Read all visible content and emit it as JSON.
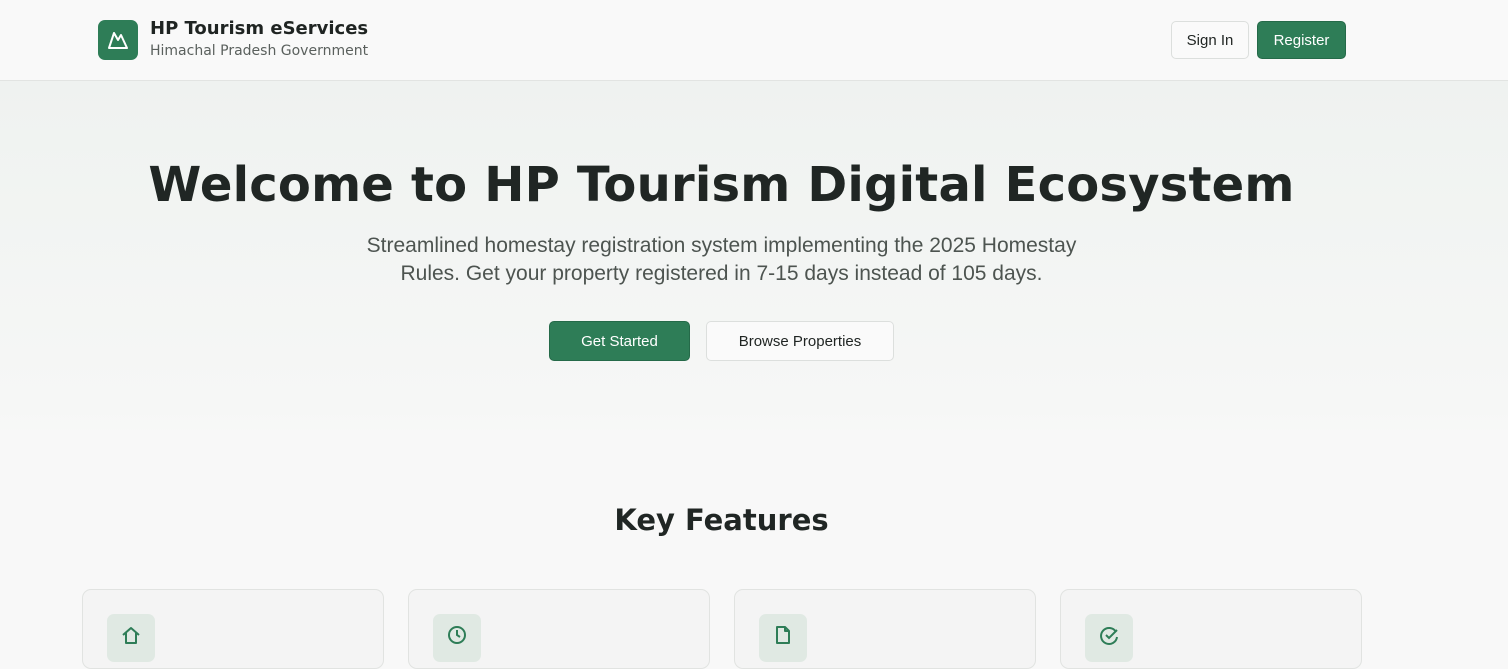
{
  "header": {
    "logo_icon": "mountain-icon",
    "title": "HP Tourism eServices",
    "subtitle": "Himachal Pradesh Government",
    "signin_label": "Sign In",
    "register_label": "Register"
  },
  "hero": {
    "title": "Welcome to HP Tourism Digital Ecosystem",
    "subtitle": "Streamlined homestay registration system implementing the 2025 Homestay Rules. Get your property registered in 7-15 days instead of 105 days.",
    "primary_cta": "Get Started",
    "secondary_cta": "Browse Properties"
  },
  "features": {
    "title": "Key Features",
    "cards": [
      {
        "icon": "home-icon"
      },
      {
        "icon": "clock-icon"
      },
      {
        "icon": "document-icon"
      },
      {
        "icon": "refresh-check-icon"
      }
    ]
  },
  "colors": {
    "brand": "#2e7d57",
    "icon_bg": "#e0e9e3",
    "text": "#1f2422"
  }
}
